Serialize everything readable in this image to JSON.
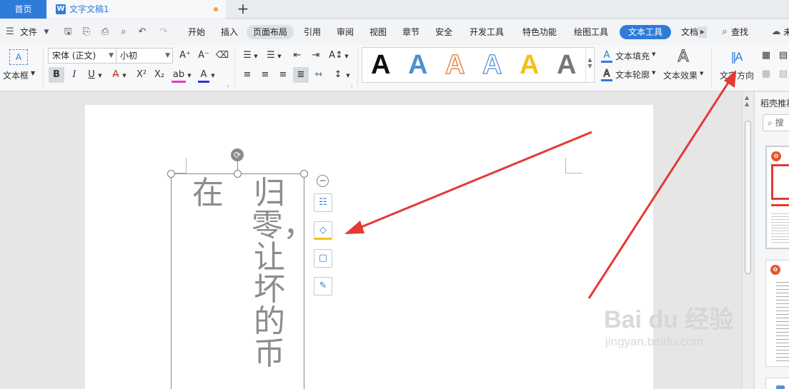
{
  "tabs": {
    "home": "首页",
    "doc_icon": "W",
    "doc_title": "文字文稿1",
    "add": "+"
  },
  "menu": {
    "file": "文件",
    "items": [
      "开始",
      "插入",
      "页面布局",
      "引用",
      "审阅",
      "视图",
      "章节",
      "安全",
      "开发工具",
      "特色功能",
      "绘图工具",
      "文本工具",
      "文档"
    ],
    "active_grey": "页面布局",
    "active_blue": "文本工具",
    "search": "查找",
    "partial_right": "未"
  },
  "ribbon": {
    "textbox_label": "文本框",
    "textbox_icon": "A",
    "font_name": "宋体 (正文)",
    "font_size": "小初",
    "grow_font": "A⁺",
    "shrink_font": "A⁻",
    "bold": "B",
    "italic": "I",
    "underline": "U",
    "strike": "A",
    "superscript": "X²",
    "subscript": "X₂",
    "highlight": "ab",
    "font_color": "A",
    "style_samples": [
      {
        "label": "A",
        "color": "#111111",
        "variant": "solid"
      },
      {
        "label": "A",
        "color": "#4f8fd1",
        "variant": "solid"
      },
      {
        "label": "A",
        "color": "#e8874a",
        "variant": "outline"
      },
      {
        "label": "A",
        "color": "#4f8fd1",
        "variant": "outline"
      },
      {
        "label": "A",
        "color": "#f3c11a",
        "variant": "solid"
      },
      {
        "label": "A",
        "color": "#777777",
        "variant": "gradient"
      }
    ],
    "text_fill": "文本填充",
    "text_outline": "文本轮廓",
    "text_effect": "文本效果",
    "text_effect_icon": "A",
    "text_direction": "文字方向"
  },
  "document": {
    "columns": [
      "在",
      "归零，让坏的币"
    ],
    "text_color": "#8c8c8c"
  },
  "float_tools": [
    "layout-options",
    "fill",
    "outline",
    "format-painter"
  ],
  "sidepane": {
    "title": "稻壳推荐",
    "search_placeholder": "搜"
  },
  "watermark": {
    "main": "Bai du 经验",
    "sub": "jingyan.baidu.com"
  },
  "colors": {
    "accent": "#2f7bd9",
    "annotation_arrow": "#e53935",
    "modified_dot": "#f0a040"
  }
}
